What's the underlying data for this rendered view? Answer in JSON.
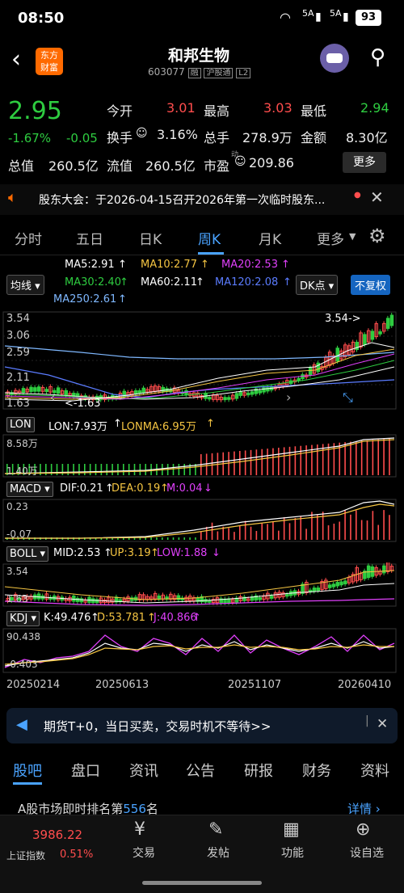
{
  "status": {
    "time": "08:50",
    "network1": "5A",
    "network2": "5A",
    "battery": "93"
  },
  "header": {
    "brand_line1": "东方",
    "brand_line2": "财富",
    "stock_name": "和邦生物",
    "code": "603077",
    "tag1": "融",
    "tag2": "沪股通",
    "tag3": "L2"
  },
  "quote": {
    "price": "2.95",
    "pct": "-1.67%",
    "chg": "-0.05",
    "open_label": "今开",
    "open": "3.01",
    "high_label": "最高",
    "high": "3.03",
    "low_label": "最低",
    "low": "2.94",
    "turnover_label": "换手",
    "turnover": "3.16%",
    "volume_label": "总手",
    "volume": "278.9万",
    "amount_label": "金额",
    "amount": "8.30亿",
    "mktcap_label": "总值",
    "mktcap": "260.5亿",
    "float_label": "流值",
    "float": "260.5亿",
    "pe_label": "市盈",
    "pe_sup": "动",
    "pe": "209.86",
    "more": "更多"
  },
  "notice": {
    "text": "股东大会：于2026-04-15召开2026年第一次临时股东..."
  },
  "period_tabs": [
    "分时",
    "五日",
    "日K",
    "周K",
    "月K",
    "更多"
  ],
  "ma": {
    "type_btn": "均线",
    "ma5": "MA5:2.91",
    "ma10": "MA10:2.77",
    "ma20": "MA20:2.53",
    "ma30": "MA30:2.40",
    "ma60": "MA60:2.11",
    "ma120": "MA120:2.08",
    "ma250": "MA250:2.61",
    "dk_btn": "DK点",
    "fq_btn": "不复权"
  },
  "main_chart": {
    "y1": "3.54",
    "y2": "3.06",
    "y3": "2.59",
    "y4": "2.11",
    "y5": "1.63",
    "high_marker": "3.54->",
    "low_marker": "<-1.63"
  },
  "lon": {
    "btn": "LON",
    "v1": "LON:7.93万",
    "v2": "LONMA:6.95万",
    "ytop": "8.58万",
    "ybot": "1.40万"
  },
  "macd": {
    "btn": "MACD",
    "dif": "DIF:0.21",
    "dea": "DEA:0.19",
    "m": "M:0.04",
    "ytop": "0.23",
    "ybot": "-0.07"
  },
  "boll": {
    "btn": "BOLL",
    "mid": "MID:2.53",
    "up": "UP:3.19",
    "low": "LOW:1.88",
    "ytop": "3.54",
    "ybot": "1.63"
  },
  "kdj": {
    "btn": "KDJ",
    "k": "K:49.476",
    "d": "D:53.781",
    "j": "J:40.866",
    "ytop": "90.438",
    "ybot": "-0.403"
  },
  "dates": [
    "20250214",
    "20250613",
    "20251107",
    "20260410"
  ],
  "ad": {
    "text": "期货T+0，当日买卖，交易时机不等待>>"
  },
  "bottom_tabs": [
    "股吧",
    "盘口",
    "资讯",
    "公告",
    "研报",
    "财务",
    "资料"
  ],
  "rank": {
    "text_pre": "A股市场即时排名第",
    "num": "556",
    "text_post": "名",
    "detail": "详情"
  },
  "index": {
    "value": "3986.22",
    "name": "上证指数",
    "pct": "0.51%"
  },
  "nav": [
    "交易",
    "发帖",
    "功能",
    "设自选"
  ],
  "colors": {
    "up": "#ff4d4d",
    "down": "#2ecc40",
    "accent": "#4aa3ff",
    "brand": "#ff6a00"
  }
}
